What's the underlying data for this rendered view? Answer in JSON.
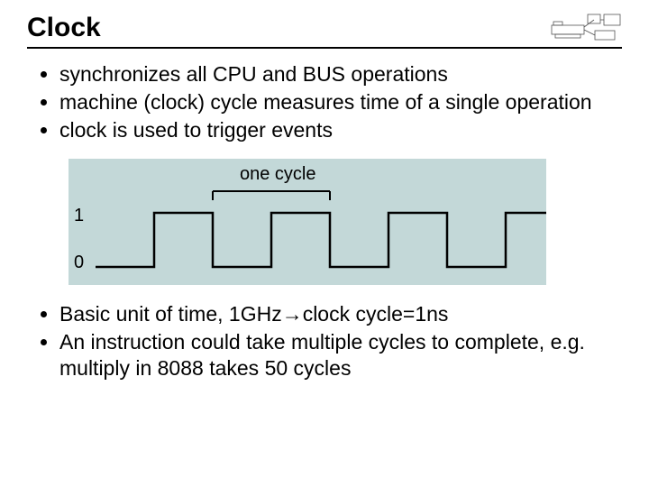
{
  "title": "Clock",
  "bullets_top": [
    "synchronizes all CPU and BUS operations",
    "machine (clock) cycle measures time of a single operation",
    "clock is used to trigger events"
  ],
  "diagram": {
    "one_cycle_label": "one cycle",
    "level_high": "1",
    "level_low": "0"
  },
  "bullets_bottom": [
    "Basic unit of time, 1GHz→clock cycle=1ns",
    "An instruction could take multiple cycles to complete, e.g. multiply in 8088 takes 50 cycles"
  ]
}
